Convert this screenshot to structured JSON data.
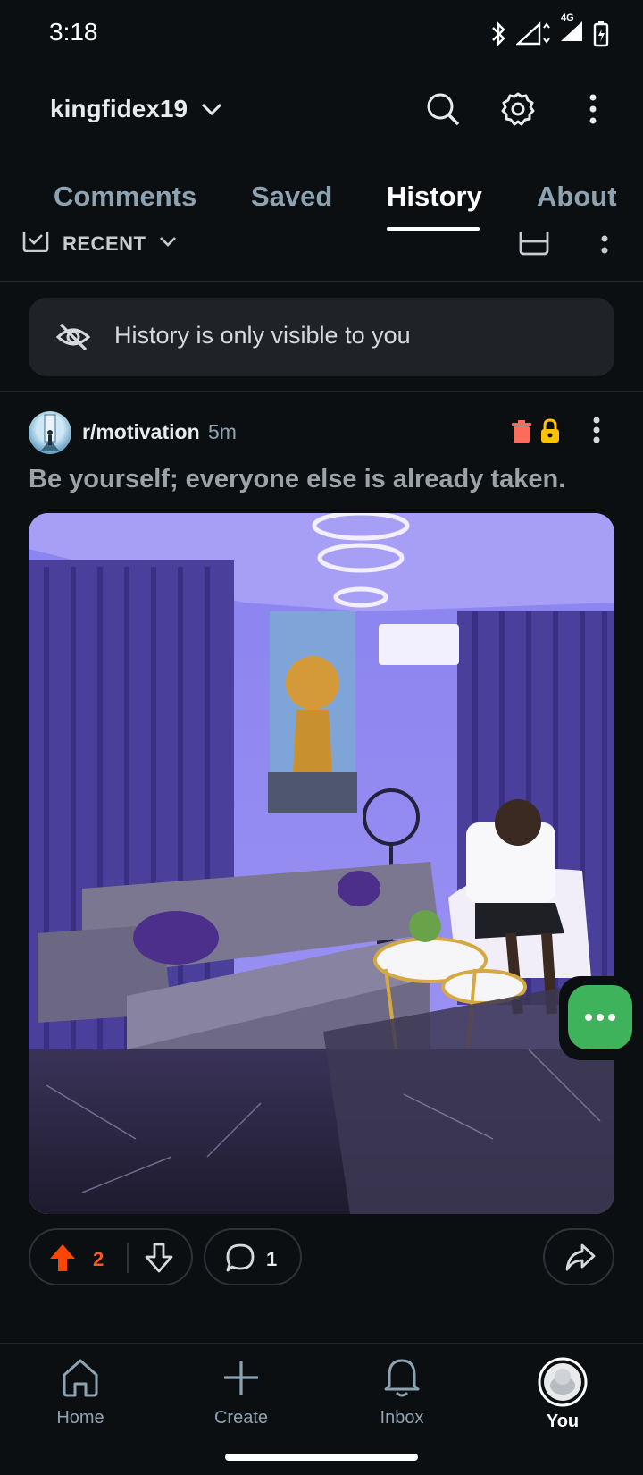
{
  "status_bar": {
    "time": "3:18",
    "network": "4G"
  },
  "header": {
    "username": "kingfidex19"
  },
  "tabs": [
    {
      "label": "Comments",
      "active": false
    },
    {
      "label": "Saved",
      "active": false
    },
    {
      "label": "History",
      "active": true
    },
    {
      "label": "About",
      "active": false
    }
  ],
  "filter": {
    "sort_label": "RECENT"
  },
  "notice": {
    "text": "History is only visible to you"
  },
  "post": {
    "subreddit": "r/motivation",
    "time": "5m",
    "title": "Be yourself; everyone else is already taken.",
    "upvotes": "2",
    "comments": "1"
  },
  "bottom_nav": [
    {
      "label": "Home",
      "icon": "home-icon",
      "active": false
    },
    {
      "label": "Create",
      "icon": "plus-icon",
      "active": false
    },
    {
      "label": "Inbox",
      "icon": "bell-icon",
      "active": false
    },
    {
      "label": "You",
      "icon": "avatar-icon",
      "active": true
    }
  ],
  "colors": {
    "upvote": "#ff4500",
    "fab": "#3fb35b",
    "background": "#0b0f12"
  }
}
